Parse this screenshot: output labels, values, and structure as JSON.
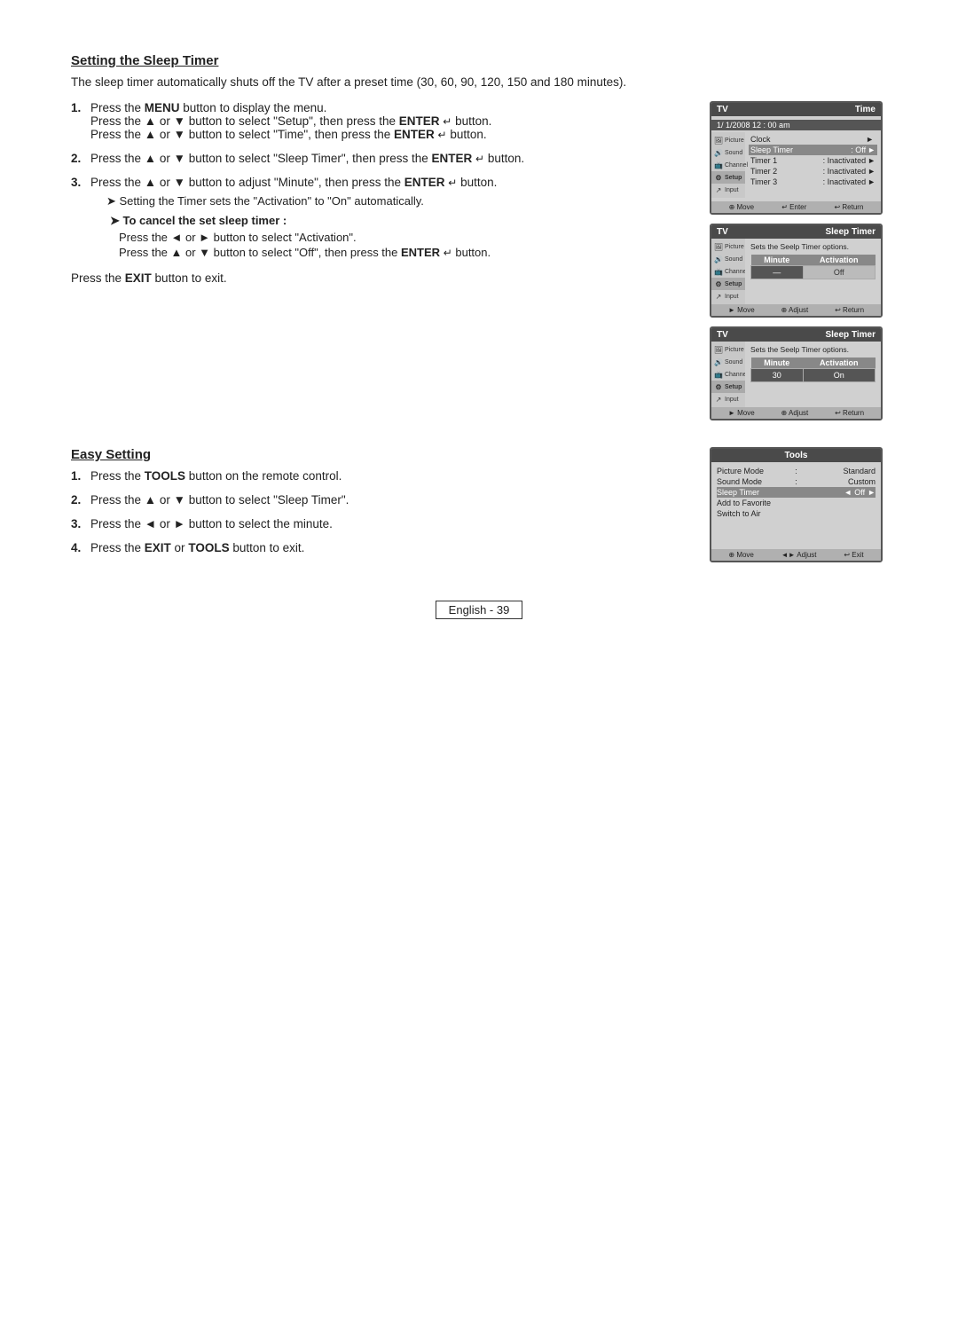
{
  "page": {
    "section1_title": "Setting the Sleep Timer",
    "intro": "The sleep timer automatically shuts off the TV after a preset time (30, 60, 90, 120, 150 and 180 minutes).",
    "step1": {
      "num": "1.",
      "lines": [
        "Press the MENU button to display the menu.",
        "Press the ▲ or ▼ button to select \"Setup\", then press the ENTER ↵ button.",
        "Press the ▲ or ▼ button to select \"Time\", then press the ENTER ↵ button."
      ]
    },
    "step2": {
      "num": "2.",
      "line": "Press the ▲ or ▼ button to select \"Sleep Timer\", then press the ENTER ↵ button."
    },
    "step3": {
      "num": "3.",
      "line": "Press the ▲ or ▼ button to adjust \"Minute\", then press the ENTER ↵ button.",
      "sub": "➤  Setting the Timer sets the \"Activation\" to \"On\" automatically.",
      "cancel_title": "➤  To cancel the set sleep timer :",
      "cancel1": "Press the ◄ or ► button to select \"Activation\".",
      "cancel2": "Press the ▲ or ▼ button to select \"Off\", then press the ENTER ↵ button."
    },
    "exit_line": "Press the EXIT button to exit.",
    "screen1": {
      "tv_label": "TV",
      "menu_title": "Time",
      "date": "1/ 1/2008 12 : 00 am",
      "clock_label": "Clock",
      "sleep_timer_label": "Sleep Timer",
      "sleep_timer_value": ": Off",
      "timer1_label": "Timer 1",
      "timer1_value": ": Inactivated",
      "timer2_label": "Timer 2",
      "timer2_value": ": Inactivated",
      "timer3_label": "Timer 3",
      "timer3_value": ": Inactivated",
      "footer_move": "⊕ Move",
      "footer_enter": "↵ Enter",
      "footer_return": "↩ Return",
      "nav_items": [
        "Picture",
        "Sound",
        "Channel",
        "Setup",
        "Input"
      ]
    },
    "screen2": {
      "tv_label": "TV",
      "menu_title": "Sleep Timer",
      "desc": "Sets the Seelp Timer options.",
      "col1": "Minute",
      "col2": "Activation",
      "val1": "—",
      "val2": "Off",
      "footer_move": "► Move",
      "footer_adjust": "⊕ Adjust",
      "footer_return": "↩ Return",
      "nav_items": [
        "Picture",
        "Sound",
        "Channel",
        "Setup",
        "Input"
      ]
    },
    "screen3": {
      "tv_label": "TV",
      "menu_title": "Sleep Timer",
      "desc": "Sets the Seelp Timer options.",
      "col1": "Minute",
      "col2": "Activation",
      "val1": "30",
      "val2": "On",
      "footer_move": "► Move",
      "footer_adjust": "⊕ Adjust",
      "footer_return": "↩ Return",
      "nav_items": [
        "Picture",
        "Sound",
        "Channel",
        "Setup",
        "Input"
      ]
    },
    "section2_title": "Easy Setting",
    "easy_steps": [
      {
        "num": "1.",
        "text": "Press the TOOLS button on the remote control."
      },
      {
        "num": "2.",
        "text": "Press the ▲ or ▼ button to select \"Sleep Timer\"."
      },
      {
        "num": "3.",
        "text": "Press the ◄ or ► button to select the minute."
      },
      {
        "num": "4.",
        "text": "Press the EXIT or TOOLS button to exit."
      }
    ],
    "tools_screen": {
      "title": "Tools",
      "picture_mode_label": "Picture Mode",
      "picture_mode_value": "Standard",
      "sound_mode_label": "Sound Mode",
      "sound_mode_value": "Custom",
      "sleep_timer_label": "Sleep Timer",
      "sleep_timer_left": "◄",
      "sleep_timer_value": "Off",
      "sleep_timer_right": "►",
      "add_favorite": "Add to Favorite",
      "switch_air": "Switch to Air",
      "footer_move": "⊕ Move",
      "footer_adjust": "◄► Adjust",
      "footer_exit": "↩ Exit"
    },
    "footer": "English - 39"
  }
}
